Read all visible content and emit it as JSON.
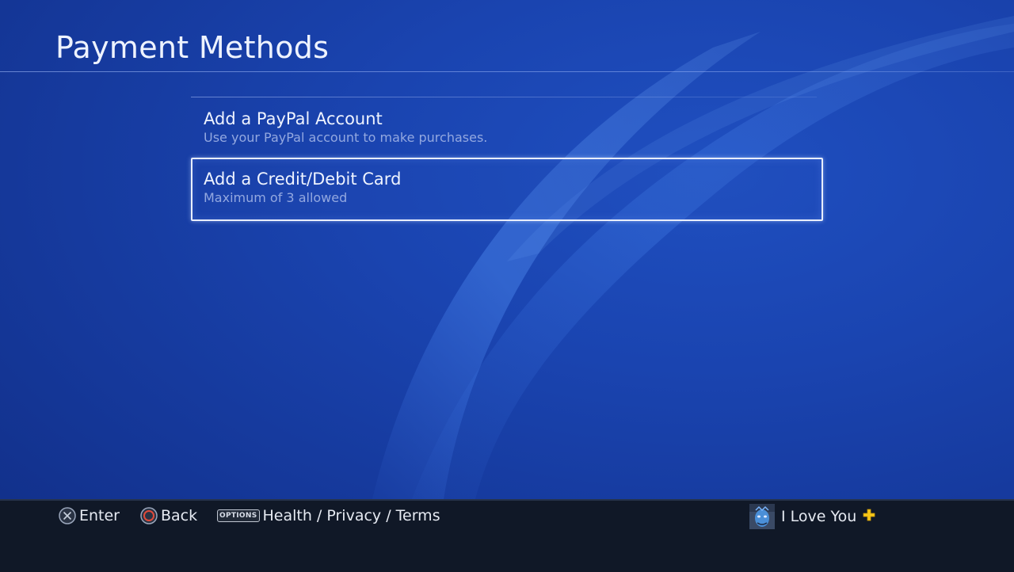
{
  "header": {
    "title": "Payment Methods"
  },
  "menu": {
    "items": [
      {
        "label": "Add a PayPal Account",
        "description": "Use your PayPal account to make purchases.",
        "selected": false
      },
      {
        "label": "Add a Credit/Debit Card",
        "description": "Maximum of 3 allowed",
        "selected": true
      }
    ]
  },
  "footer": {
    "enter": {
      "icon": "cross-button-icon",
      "label": "Enter"
    },
    "back": {
      "icon": "circle-button-icon",
      "label": "Back"
    },
    "options": {
      "badge": "OPTIONS",
      "label": "Health / Privacy / Terms"
    },
    "user": {
      "name": "I Love You",
      "icons": [
        "avatar",
        "playstation-plus-icon"
      ]
    }
  },
  "colors": {
    "background": "#1a44b0",
    "footer": "#101827",
    "circle_button": "#e04a3a",
    "plus_badge": "#f5c518"
  }
}
